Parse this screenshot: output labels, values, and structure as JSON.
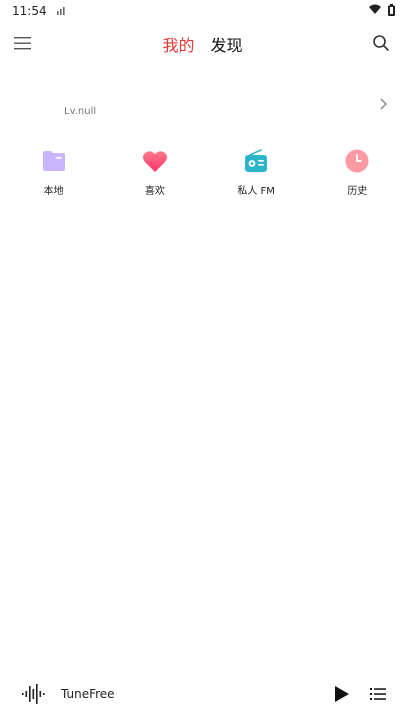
{
  "status_bar": {
    "time": "11:54",
    "icons": [
      "signal-bars-icon",
      "wifi-icon",
      "battery-icon"
    ]
  },
  "header": {
    "menu_icon": "hamburger-menu-icon",
    "search_icon": "search-icon",
    "tabs": [
      {
        "label": "我的",
        "active": true
      },
      {
        "label": "发现",
        "active": false
      }
    ],
    "active_color": "#e53935"
  },
  "profile": {
    "level": "Lv.null",
    "chevron_icon": "chevron-right-icon"
  },
  "quick_actions": [
    {
      "label": "本地",
      "icon": "folder-icon",
      "color": "#c9b5ff"
    },
    {
      "label": "喜欢",
      "icon": "heart-icon",
      "color": "#ff4d73"
    },
    {
      "label": "私人 FM",
      "icon": "radio-icon",
      "color": "#2bb5c9"
    },
    {
      "label": "历史",
      "icon": "clock-icon",
      "color": "#ff9aa5"
    }
  ],
  "player": {
    "title": "TuneFree",
    "wave_icon": "sound-wave-icon",
    "play_icon": "play-icon",
    "playlist_icon": "playlist-icon"
  }
}
